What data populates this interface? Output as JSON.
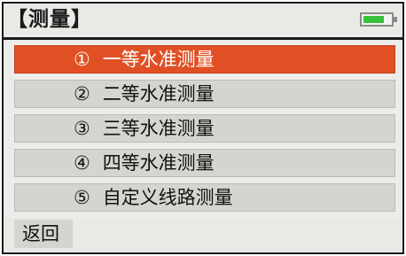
{
  "header": {
    "title": "【测量】",
    "battery": {
      "level": 0.75,
      "color": "#38c13a"
    }
  },
  "menu": {
    "selected_index": 0,
    "selected_color": "#e05024",
    "items": [
      {
        "number": "①",
        "label": "一等水准测量"
      },
      {
        "number": "②",
        "label": "二等水准测量"
      },
      {
        "number": "③",
        "label": "三等水准测量"
      },
      {
        "number": "④",
        "label": "四等水准测量"
      },
      {
        "number": "⑤",
        "label": "自定义线路测量"
      }
    ]
  },
  "footer": {
    "back_label": "返回"
  }
}
